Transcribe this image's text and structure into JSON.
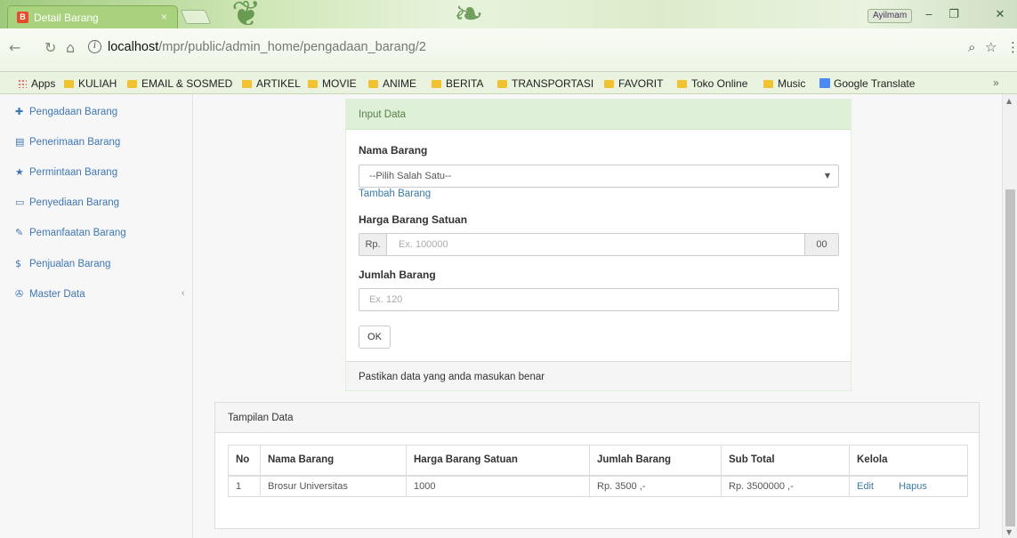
{
  "browser": {
    "tab_title": "Detail Barang",
    "tab_favicon": "bs-icon",
    "user_badge": "Ayilmam",
    "url_host": "localhost",
    "url_path": "/mpr/public/admin_home/pengadaan_barang/2",
    "bookmarks": [
      {
        "label": "Apps",
        "icon": "apps-icon"
      },
      {
        "label": "KULIAH",
        "icon": "folder-icon"
      },
      {
        "label": "EMAIL & SOSMED",
        "icon": "folder-icon"
      },
      {
        "label": "ARTIKEL",
        "icon": "folder-icon"
      },
      {
        "label": "MOVIE",
        "icon": "folder-icon"
      },
      {
        "label": "ANIME",
        "icon": "folder-icon"
      },
      {
        "label": "BERITA",
        "icon": "folder-icon"
      },
      {
        "label": "TRANSPORTASI",
        "icon": "folder-icon"
      },
      {
        "label": "FAVORIT",
        "icon": "folder-icon"
      },
      {
        "label": "Toko Online",
        "icon": "folder-icon"
      },
      {
        "label": "Music",
        "icon": "folder-icon"
      },
      {
        "label": "Google Translate",
        "icon": "google-translate-icon"
      }
    ],
    "bookmarks_more": "»"
  },
  "sidebar": {
    "items": [
      {
        "label": "Pengadaan Barang",
        "icon": "plus-icon",
        "glyph": "✚"
      },
      {
        "label": "Penerimaan Barang",
        "icon": "table-icon",
        "glyph": "▤"
      },
      {
        "label": "Permintaan Barang",
        "icon": "star-icon",
        "glyph": "★"
      },
      {
        "label": "Penyediaan Barang",
        "icon": "hdd-icon",
        "glyph": "▭"
      },
      {
        "label": "Pemanfaatan Barang",
        "icon": "edit-icon",
        "glyph": "✎"
      },
      {
        "label": "Penjualan Barang",
        "icon": "dollar-icon",
        "glyph": "$"
      },
      {
        "label": "Master Data",
        "icon": "wrench-icon",
        "glyph": "✇"
      }
    ],
    "master_arrow": "‹"
  },
  "form": {
    "header": "Input Data",
    "nama_label": "Nama Barang",
    "nama_select_value": "--Pilih Salah Satu--",
    "tambah_link": "Tambah Barang",
    "harga_label": "Harga Barang Satuan",
    "harga_prefix": "Rp.",
    "harga_placeholder": "Ex. 100000",
    "harga_suffix": "00",
    "jumlah_label": "Jumlah Barang",
    "jumlah_placeholder": "Ex. 120",
    "ok_label": "OK",
    "footer": "Pastikan data yang anda masukan benar"
  },
  "table": {
    "header": "Tampilan Data",
    "columns": [
      "No",
      "Nama Barang",
      "Harga Barang Satuan",
      "Jumlah Barang",
      "Sub Total",
      "Kelola"
    ],
    "rows": [
      {
        "no": "1",
        "nama": "Brosur Universitas",
        "harga": "1000",
        "jumlah": "Rp. 3500 ,-",
        "subtotal": "Rp. 3500000 ,-",
        "edit": "Edit",
        "hapus": "Hapus"
      }
    ]
  }
}
